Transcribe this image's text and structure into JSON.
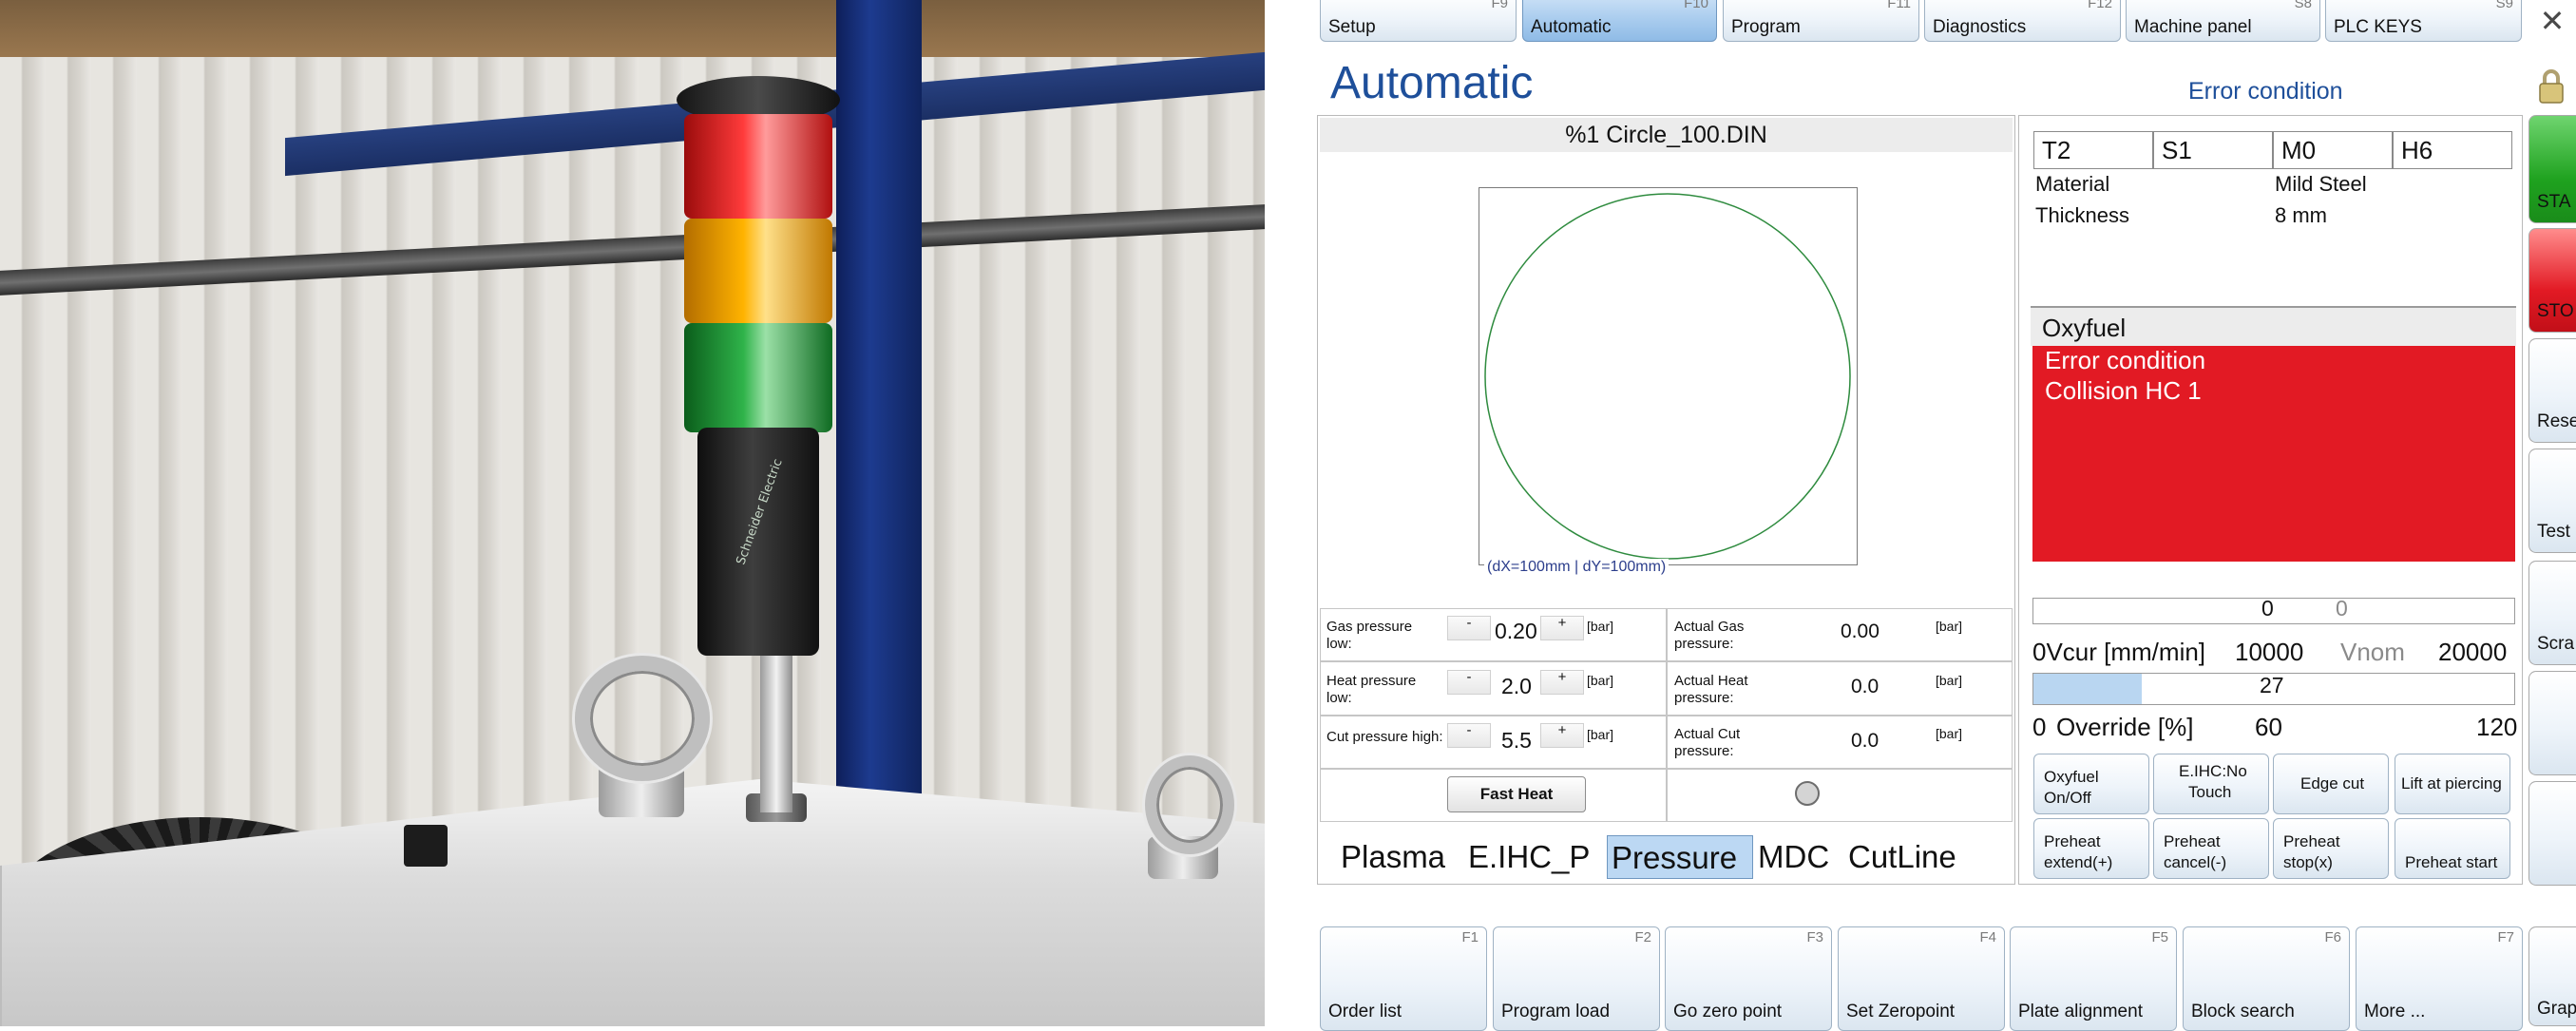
{
  "top_tabs": [
    {
      "label": "Setup",
      "key": "F9"
    },
    {
      "label": "Automatic",
      "key": "F10"
    },
    {
      "label": "Program",
      "key": "F11"
    },
    {
      "label": "Diagnostics",
      "key": "F12"
    },
    {
      "label": "Machine panel",
      "key": "S8"
    },
    {
      "label": "PLC KEYS",
      "key": "S9"
    }
  ],
  "page_title": "Automatic",
  "status_title": "Error condition",
  "program": {
    "name": "%1 Circle_100.DIN",
    "preview_dims": "(dX=100mm | dY=100mm)"
  },
  "params": [
    {
      "label_a": "Gas pressure",
      "label_b": "low:",
      "minus": "-",
      "plus": "+",
      "value": "0.20",
      "unit": "[bar]",
      "actual_a": "Actual Gas",
      "actual_b": "pressure:",
      "actual_value": "0.00",
      "actual_unit": "[bar]"
    },
    {
      "label_a": "Heat pressure",
      "label_b": "low:",
      "minus": "-",
      "plus": "+",
      "value": "2.0",
      "unit": "[bar]",
      "actual_a": "Actual Heat",
      "actual_b": "pressure:",
      "actual_value": "0.0",
      "actual_unit": "[bar]"
    },
    {
      "label_a": "Cut pressure high:",
      "label_b": "",
      "minus": "-",
      "plus": "+",
      "value": "5.5",
      "unit": "[bar]",
      "actual_a": "Actual Cut",
      "actual_b": "pressure:",
      "actual_value": "0.0",
      "actual_unit": "[bar]"
    }
  ],
  "fast_heat_label": "Fast Heat",
  "bottom_tabs": [
    "Plasma",
    "E.IHC_P",
    "Pressure",
    "MDC",
    "CutLine"
  ],
  "tool": {
    "t": "T2",
    "s": "S1",
    "m": "M0",
    "h": "H6"
  },
  "material_label": "Material",
  "material_value": "Mild Steel",
  "thickness_label": "Thickness",
  "thickness_value": "8 mm",
  "process": "Oxyfuel",
  "error_lines": [
    "Error condition",
    "Collision HC 1"
  ],
  "speed": {
    "vcur": "0",
    "vnom": "0",
    "scale_min_label": "0Vcur [mm/min]",
    "scale_mid": "10000",
    "vnom_label": "Vnom",
    "scale_max": "20000",
    "fill_fraction": 0
  },
  "override": {
    "value": "27",
    "fill_fraction": 0.225,
    "scale_min_label": "0",
    "label": "Override [%]",
    "scale_mid": "60",
    "scale_max": "120"
  },
  "soft_buttons": [
    [
      "Oxyfuel",
      "On/Off"
    ],
    [
      "E.IHC:No",
      "Touch"
    ],
    [
      "Edge cut"
    ],
    [
      "Lift at piercing"
    ],
    [
      "Preheat",
      "extend(+)"
    ],
    [
      "Preheat",
      "cancel(-)"
    ],
    [
      "Preheat",
      "stop(x)"
    ],
    [
      "Preheat start"
    ]
  ],
  "side_buttons": {
    "start": "STA",
    "stop": "STO",
    "reset": "Rese",
    "test": "Test",
    "scra": "Scra",
    "grap": "Grap"
  },
  "fkeys": [
    {
      "label": "Order list",
      "key": "F1"
    },
    {
      "label": "Program load",
      "key": "F2"
    },
    {
      "label": "Go zero point",
      "key": "F3"
    },
    {
      "label": "Set Zeropoint",
      "key": "F4"
    },
    {
      "label": "Plate alignment",
      "key": "F5"
    },
    {
      "label": "Block search",
      "key": "F6"
    },
    {
      "label": "More ...",
      "key": "F7"
    }
  ],
  "colors": {
    "accent": "#1e4f9a",
    "error": "#e21a24",
    "preview_path": "#2e8b3e",
    "start": "#1fa21f"
  }
}
